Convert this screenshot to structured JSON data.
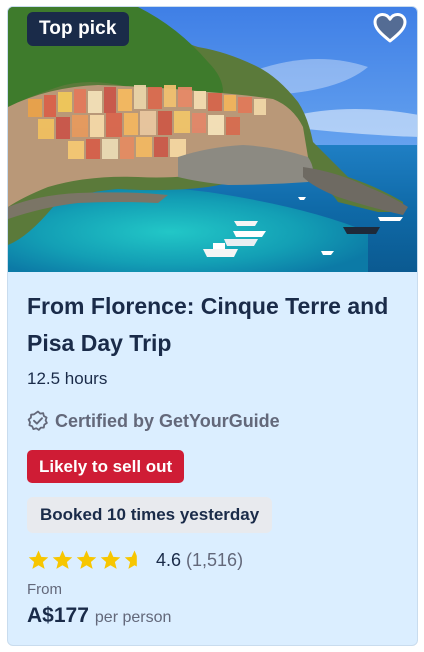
{
  "card": {
    "badge": "Top pick",
    "title": "From Florence: Cinque Terre and Pisa Day Trip",
    "duration": "12.5 hours",
    "certified": "Certified by GetYourGuide",
    "likely_label": "Likely to sell out",
    "booked_label": "Booked 10 times yesterday",
    "rating": {
      "value": "4.6",
      "count": "(1,516)",
      "stars": 4.6
    },
    "price": {
      "from_label": "From",
      "amount": "A$177",
      "unit": "per person"
    }
  },
  "icons": {
    "wishlist": "heart-icon",
    "certified": "shield-check-icon",
    "star": "star-icon"
  },
  "colors": {
    "brand_dark": "#1a2b49",
    "card_bg": "#dbeeff",
    "sellout_bg": "#cf1c35",
    "star": "#f7c600",
    "muted": "#63687a"
  }
}
